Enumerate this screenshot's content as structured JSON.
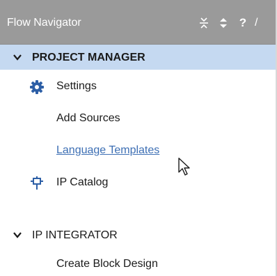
{
  "panel": {
    "title": "Flow Navigator",
    "header_icons": [
      {
        "name": "collapse-all-icon"
      },
      {
        "name": "expand-collapse-icon"
      },
      {
        "name": "help-icon",
        "glyph": "?"
      },
      {
        "name": "truncated-icon",
        "glyph": "/"
      }
    ]
  },
  "sections": [
    {
      "label": "PROJECT MANAGER",
      "selected": true,
      "items": [
        {
          "label": "Settings",
          "icon": "gear-icon"
        },
        {
          "label": "Add Sources",
          "icon": ""
        },
        {
          "label": "Language Templates",
          "icon": "",
          "hovered": true
        },
        {
          "label": "IP Catalog",
          "icon": "ip-catalog-icon"
        }
      ]
    },
    {
      "label": "IP INTEGRATOR",
      "selected": false,
      "items": [
        {
          "label": "Create Block Design",
          "icon": ""
        }
      ]
    }
  ],
  "colors": {
    "header_bg": "#9a9a9a",
    "selected_bg": "#c5d9f1",
    "link": "#3d6fb4",
    "icon_blue": "#2d5fa6"
  }
}
